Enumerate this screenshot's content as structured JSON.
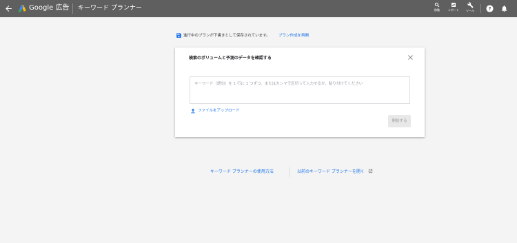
{
  "header": {
    "brand": "Google 広告",
    "page_title": "キーワード プランナー",
    "tools": [
      {
        "label": "移動",
        "icon": "search-icon"
      },
      {
        "label": "レポート",
        "icon": "report-icon"
      },
      {
        "label": "ツール",
        "icon": "wrench-icon"
      }
    ],
    "help_icon": "help-icon",
    "notifications_icon": "bell-icon"
  },
  "notice": {
    "message": "進行中のプランが下書きとして保存されています。",
    "link": "プラン作成を再開"
  },
  "card": {
    "title": "検索のボリュームと予測のデータを確認する",
    "input_placeholder": "キーワード（語句）を 1 行に 1 つずつ、またはカンマで区切って入力するか、貼り付けてください",
    "upload_label": "ファイルをアップロード",
    "start_button": "開始する"
  },
  "footer": {
    "how_to_link": "キーワード プランナーの使用方法",
    "old_version_link": "以前のキーワード プランナーを開く"
  },
  "colors": {
    "topbar": "#5f5f5f",
    "background": "#f4f4f4",
    "link": "#1a73e8"
  }
}
